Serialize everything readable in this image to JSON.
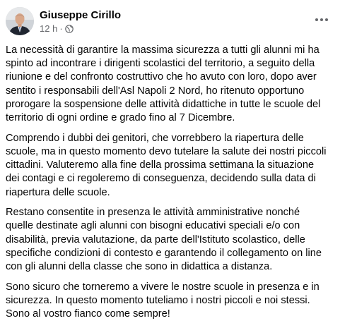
{
  "post": {
    "author": "Giuseppe Cirillo",
    "time": "12 h",
    "separator": "·",
    "audience_icon": "globe-icon",
    "menu_icon": "more-options-icon",
    "paragraphs": [
      "La necessità di garantire la massima sicurezza a tutti gli alunni mi ha\nspinto ad incontrare i dirigenti scolastici del territorio, a seguito della\nriunione e del confronto costruttivo che ho avuto con loro, dopo aver\nsentito i responsabili dell'Asl Napoli 2 Nord, ho ritenuto opportuno\nprorogare la sospensione delle attività didattiche in tutte le scuole del\nterritorio di ogni ordine e grado fino al 7 Dicembre.",
      "Comprendo i dubbi dei genitori, che vorrebbero la riapertura delle\nscuole, ma in questo momento devo tutelare la salute dei nostri piccoli\ncittadini. Valuteremo alla fine della prossima settimana la situazione\ndei contagi e ci regoleremo di conseguenza, decidendo sulla data di\nriapertura delle scuole.",
      "Restano consentite in presenza le attività amministrative nonché\nquelle destinate agli alunni con bisogni educativi speciali e/o con\ndisabilità, previa valutazione, da parte dell'Istituto scolastico, delle\nspecifiche condizioni di contesto e garantendo il collegamento on line\ncon gli alunni della classe che sono in didattica a distanza.",
      "Sono sicuro che torneremo a vivere le nostre scuole in presenza e in\nsicurezza. In questo momento tuteliamo i nostri piccoli e noi stessi.\nSono al vostro fianco come sempre!"
    ]
  },
  "colors": {
    "text": "#050505",
    "secondary": "#65676b",
    "background": "#ffffff"
  }
}
